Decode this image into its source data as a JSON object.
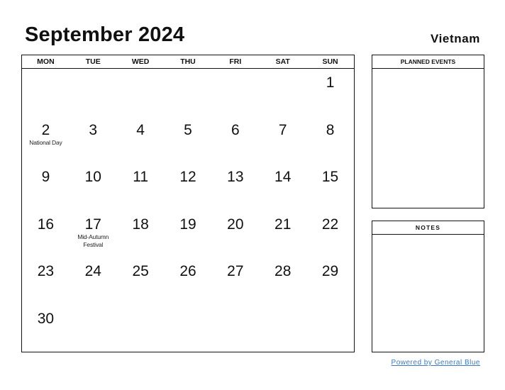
{
  "header": {
    "title": "September 2024",
    "country": "Vietnam"
  },
  "calendar": {
    "weekdays": [
      "MON",
      "TUE",
      "WED",
      "THU",
      "FRI",
      "SAT",
      "SUN"
    ],
    "days": [
      {
        "num": "",
        "event": ""
      },
      {
        "num": "",
        "event": ""
      },
      {
        "num": "",
        "event": ""
      },
      {
        "num": "",
        "event": ""
      },
      {
        "num": "",
        "event": ""
      },
      {
        "num": "",
        "event": ""
      },
      {
        "num": "1",
        "event": ""
      },
      {
        "num": "2",
        "event": "National Day"
      },
      {
        "num": "3",
        "event": ""
      },
      {
        "num": "4",
        "event": ""
      },
      {
        "num": "5",
        "event": ""
      },
      {
        "num": "6",
        "event": ""
      },
      {
        "num": "7",
        "event": ""
      },
      {
        "num": "8",
        "event": ""
      },
      {
        "num": "9",
        "event": ""
      },
      {
        "num": "10",
        "event": ""
      },
      {
        "num": "11",
        "event": ""
      },
      {
        "num": "12",
        "event": ""
      },
      {
        "num": "13",
        "event": ""
      },
      {
        "num": "14",
        "event": ""
      },
      {
        "num": "15",
        "event": ""
      },
      {
        "num": "16",
        "event": ""
      },
      {
        "num": "17",
        "event": "Mid-Autumn Festival"
      },
      {
        "num": "18",
        "event": ""
      },
      {
        "num": "19",
        "event": ""
      },
      {
        "num": "20",
        "event": ""
      },
      {
        "num": "21",
        "event": ""
      },
      {
        "num": "22",
        "event": ""
      },
      {
        "num": "23",
        "event": ""
      },
      {
        "num": "24",
        "event": ""
      },
      {
        "num": "25",
        "event": ""
      },
      {
        "num": "26",
        "event": ""
      },
      {
        "num": "27",
        "event": ""
      },
      {
        "num": "28",
        "event": ""
      },
      {
        "num": "29",
        "event": ""
      },
      {
        "num": "30",
        "event": ""
      },
      {
        "num": "",
        "event": ""
      },
      {
        "num": "",
        "event": ""
      },
      {
        "num": "",
        "event": ""
      },
      {
        "num": "",
        "event": ""
      },
      {
        "num": "",
        "event": ""
      },
      {
        "num": "",
        "event": ""
      }
    ]
  },
  "sidebar": {
    "planned_events_label": "PLANNED EVENTS",
    "notes_label": "NOTES"
  },
  "footer": {
    "powered_by": "Powered by General Blue",
    "link_color": "#3a78c8"
  }
}
